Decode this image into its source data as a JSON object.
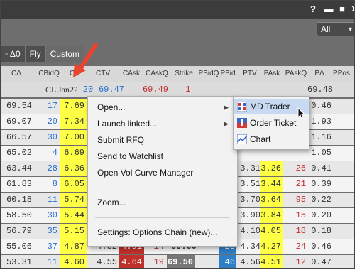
{
  "window": {
    "help": "?",
    "minimize": "▬",
    "maximize": "■",
    "close": "✕"
  },
  "filter_select": {
    "value": "All"
  },
  "strategy_buttons": {
    "delta0": "◦ Δ0",
    "fly": "Fly",
    "custom": "Custom"
  },
  "columns": [
    "CΔ",
    "CBidQ",
    "CB",
    "CTV",
    "CAsk",
    "CAskQ",
    "Strike",
    "PBidQ",
    "PBid",
    "PTV",
    "PAsk",
    "PAskQ",
    "PΔ",
    "PPos"
  ],
  "atm_row": {
    "contract": "CL Jan22",
    "cbidq": "20",
    "ctv": "69.47",
    "cask": "69.49",
    "caskq": "1",
    "pdelta": "69.48"
  },
  "rows": [
    {
      "cdelta": "69.54",
      "cbidq": "17",
      "cbid": "7.69",
      "pbid": "",
      "ptv": "",
      "pask": "",
      "paskq": "",
      "pdelta": "0.46"
    },
    {
      "cdelta": "69.07",
      "cbidq": "20",
      "cbid": "7.34",
      "pbid": "",
      "ptv": "",
      "pask": "",
      "paskq": "",
      "pdelta": "1.93"
    },
    {
      "cdelta": "66.57",
      "cbidq": "30",
      "cbid": "7.00",
      "pbid": "",
      "ptv": "",
      "pask": "",
      "paskq": "",
      "pdelta": "1.16"
    },
    {
      "cdelta": "65.02",
      "cbidq": "4",
      "cbid": "6.69",
      "pbid": "",
      "ptv": "",
      "pask": "",
      "paskq": "",
      "pdelta": "1.05"
    },
    {
      "cdelta": "63.44",
      "cbidq": "28",
      "cbid": "6.36",
      "pbid": "",
      "ptv": "3.31",
      "pask": "3.26",
      "paskq": "26",
      "pdelta": "0.41"
    },
    {
      "cdelta": "61.83",
      "cbidq": "8",
      "cbid": "6.05",
      "pbid": "",
      "ptv": "3.51",
      "pask": "3.44",
      "paskq": "21",
      "pdelta": "0.39"
    },
    {
      "cdelta": "60.18",
      "cbidq": "11",
      "cbid": "5.74",
      "pbid": "",
      "ptv": "3.70",
      "pask": "3.64",
      "paskq": "95",
      "pdelta": "0.22"
    },
    {
      "cdelta": "58.50",
      "cbidq": "30",
      "cbid": "5.44",
      "pbid": "",
      "ptv": "3.90",
      "pask": "3.84",
      "paskq": "15",
      "pdelta": "0.20"
    },
    {
      "cdelta": "56.79",
      "cbidq": "35",
      "cbid": "5.15",
      "pbid": "",
      "ptv": "4.10",
      "pask": "4.05",
      "paskq": "18",
      "pdelta": "0.18"
    },
    {
      "cdelta": "55.06",
      "cbidq": "37",
      "cbid": "4.87",
      "ctv": "4.82",
      "cask": "4.91",
      "caskq": "14",
      "strike": "69.00",
      "pbid": "23",
      "ptv": "4.34",
      "pask": "4.27",
      "paskq": "24",
      "pdelta": "0.46"
    },
    {
      "cdelta": "53.31",
      "cbidq": "11",
      "cbid": "4.60",
      "ctv": "4.55",
      "cask": "4.64",
      "caskq": "19",
      "strike": "69.50",
      "pbid": "46",
      "ptv": "4.56",
      "pask": "4.51",
      "paskq": "12",
      "pdelta": "0.47"
    }
  ],
  "context_menu": {
    "open": "Open...",
    "launch_linked": "Launch linked...",
    "submit_rfq": "Submit RFQ",
    "send_watchlist": "Send to Watchlist",
    "open_vol": "Open Vol Curve Manager",
    "zoom": "Zoom...",
    "settings": "Settings: Options Chain (new)..."
  },
  "submenu": {
    "md_trader": "MD Trader",
    "order_ticket": "Order Ticket",
    "chart": "Chart"
  },
  "colors": {
    "highlight_yellow": "#ffff44",
    "call_blue": "#2a6fd0",
    "ask_red": "#c42b2b",
    "menu_highlight": "#c7daf2"
  },
  "icons": [
    "help-icon",
    "minimize-icon",
    "maximize-icon",
    "close-icon",
    "lock-icon",
    "md-trader-icon",
    "order-ticket-icon",
    "chart-icon",
    "submenu-arrow-icon",
    "cursor-icon",
    "annotation-arrow"
  ]
}
